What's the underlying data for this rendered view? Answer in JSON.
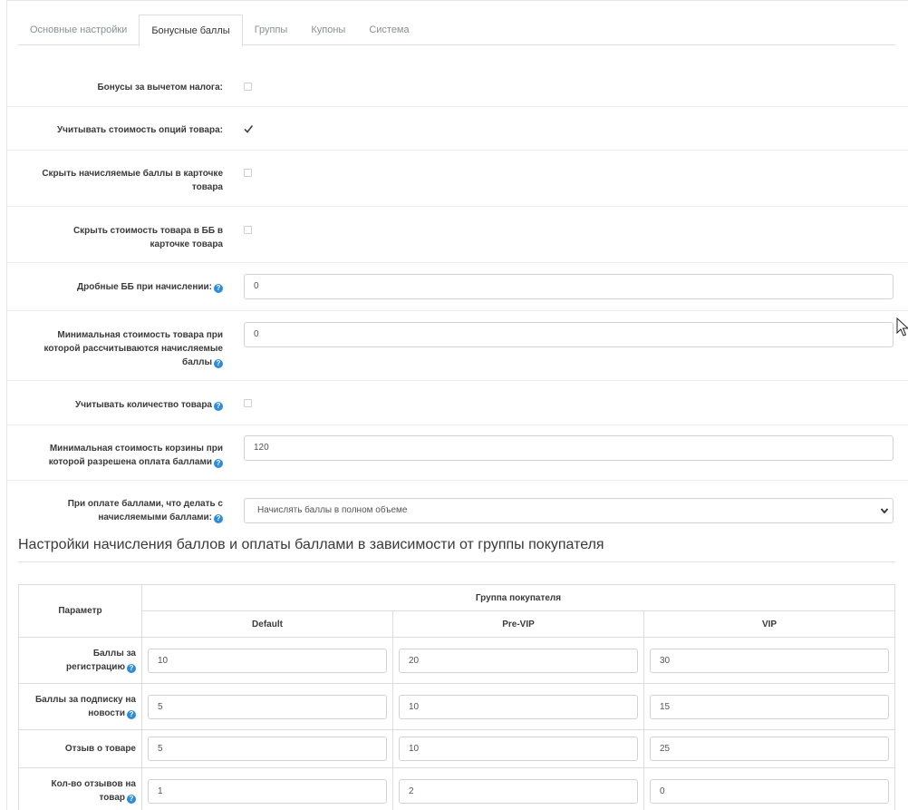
{
  "tabs": [
    {
      "label": "Основные настройки"
    },
    {
      "label": "Бонусные баллы"
    },
    {
      "label": "Группы"
    },
    {
      "label": "Купоны"
    },
    {
      "label": "Система"
    }
  ],
  "active_tab": "Бонусные баллы",
  "form": {
    "bonus_minus_tax": {
      "label_1": "Бонусы за вычетом налога:",
      "checked": false
    },
    "option_cost": {
      "label_1": "Учитывать стоимость опций товара:",
      "checked": true
    },
    "hide_accrued": {
      "label_1": "Скрыть начисляемые баллы в карточке",
      "label_2": "товара",
      "checked": false
    },
    "hide_cost_bb": {
      "label_1": "Скрыть стоимость товара в ББ в",
      "label_2": "карточке товара",
      "checked": false
    },
    "fractional": {
      "label_1": "Дробные ББ при начислении:",
      "value": "0"
    },
    "min_product_cost": {
      "label_1": "Минимальная стоимость товара при",
      "label_2": "которой рассчитываются начисляемые",
      "label_3": "баллы",
      "value": "0"
    },
    "count_quantity": {
      "label_1": "Учитывать количество товара",
      "checked": false
    },
    "min_cart_cost": {
      "label_1": "Минимальная стоимость корзины при",
      "label_2": "которой разрешена оплата баллами",
      "value": "120"
    },
    "on_pay": {
      "label_1": "При оплате баллами, что делать с",
      "label_2": "начисляемыми баллами:",
      "selected": "Начислять баллы в полном объеме"
    }
  },
  "section_title": "Настройки начисления баллов и оплаты баллами в зависимости от группы покупателя",
  "table": {
    "param_header": "Параметр",
    "group_header": "Группа покупателя",
    "groups": [
      "Default",
      "Pre-VIP",
      "VIP"
    ],
    "rows": [
      {
        "label_1": "Баллы за",
        "label_2": "регистрацию",
        "values": [
          "10",
          "20",
          "30"
        ]
      },
      {
        "label_1": "Баллы за подписку на",
        "label_2": "новости",
        "values": [
          "5",
          "10",
          "15"
        ]
      },
      {
        "label_1": "Отзыв о товаре",
        "values": [
          "5",
          "10",
          "25"
        ]
      },
      {
        "label_1": "Кол-во отзывов на",
        "label_2": "товар",
        "values": [
          "1",
          "2",
          "0"
        ]
      }
    ]
  },
  "icons": {
    "help": "question-circle-icon",
    "check": "check-icon",
    "chevron": "chevron-down-icon",
    "cursor": "mouse-pointer-icon"
  },
  "colors": {
    "help_icon": "#2f8cd8",
    "border": "#dddddd"
  }
}
